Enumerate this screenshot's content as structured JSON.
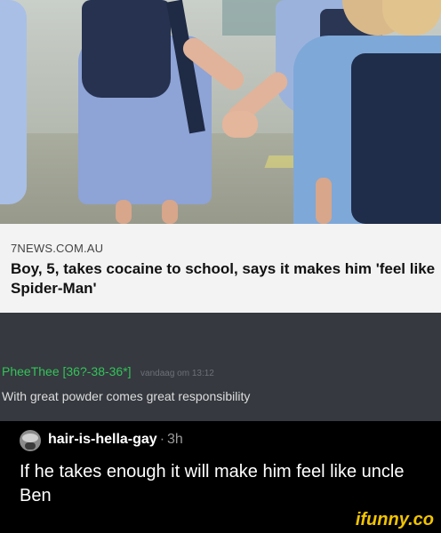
{
  "news": {
    "source": "7NEWS.COM.AU",
    "headline": "Boy, 5, takes cocaine to school, says it makes him 'feel like Spider-Man'"
  },
  "discord": {
    "username": "PheeThee [36?-38-36*]",
    "timestamp": "vandaag om 13:12",
    "message": "With great powder comes great responsibility"
  },
  "comment": {
    "username": "hair-is-hella-gay",
    "separator": "·",
    "time": "3h",
    "text": "If he takes enough it will make him feel like uncle Ben"
  },
  "watermark": "ifunny.co",
  "colors": {
    "discord_bg": "#36393f",
    "discord_username": "#33c45a",
    "ifunny_yellow": "#f2c400"
  }
}
